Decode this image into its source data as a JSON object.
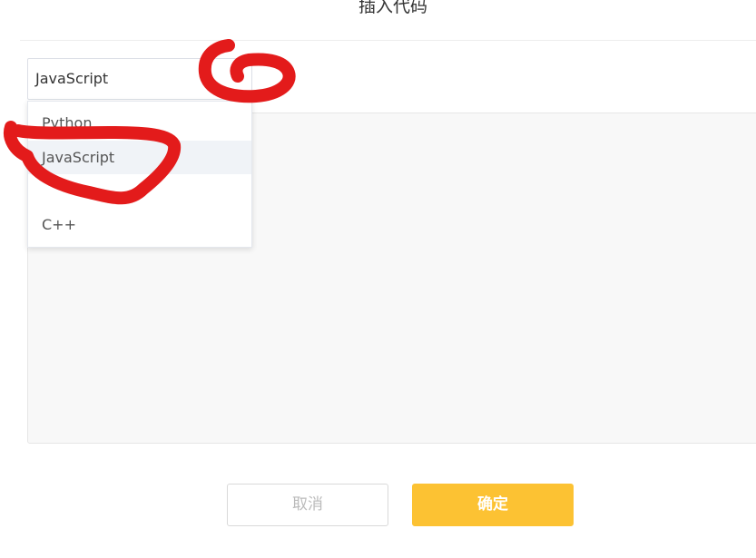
{
  "dialog": {
    "title": "插入代码"
  },
  "language_select": {
    "selected_value": "JavaScript",
    "options": [
      {
        "label": "Python"
      },
      {
        "label": "JavaScript",
        "selected": true
      },
      {
        "label": ""
      },
      {
        "label": "C++"
      }
    ]
  },
  "code_editor": {
    "value": "",
    "placeholder": ""
  },
  "actions": {
    "cancel_label": "取消",
    "confirm_label": "确定"
  },
  "colors": {
    "confirm_button": "#fcc233",
    "selected_option_bg": "#f0f3f7",
    "annotation_marker": "#e31b1b"
  },
  "annotations": [
    {
      "name": "dropdown-arrow-circle",
      "color": "#e31b1b"
    },
    {
      "name": "javascript-option-circle",
      "color": "#e31b1b"
    }
  ]
}
